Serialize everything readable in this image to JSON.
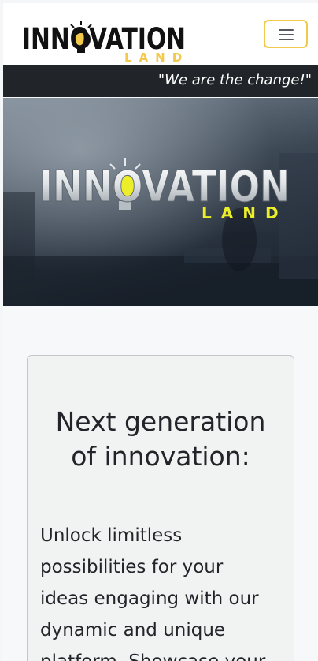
{
  "navbar": {
    "logo": {
      "brand_main": "INNOVATION",
      "brand_sub": "LAND"
    },
    "toggler_label": "Toggle navigation"
  },
  "slogan": "\"We are the change!\"",
  "hero": {
    "brand_main": "INNOVATION",
    "brand_sub": "LAND"
  },
  "card": {
    "title_line1": "Next generation",
    "title_line2": "of innovation:",
    "text_lines": [
      "Unlock limitless",
      "possibilities for your",
      "ideas engaging with our",
      "dynamic and unique",
      "platform. Showcase your"
    ]
  },
  "colors": {
    "accent_yellow": "#f2c94c",
    "dark_bar": "#212529",
    "card_bg": "#f1f2f2"
  }
}
